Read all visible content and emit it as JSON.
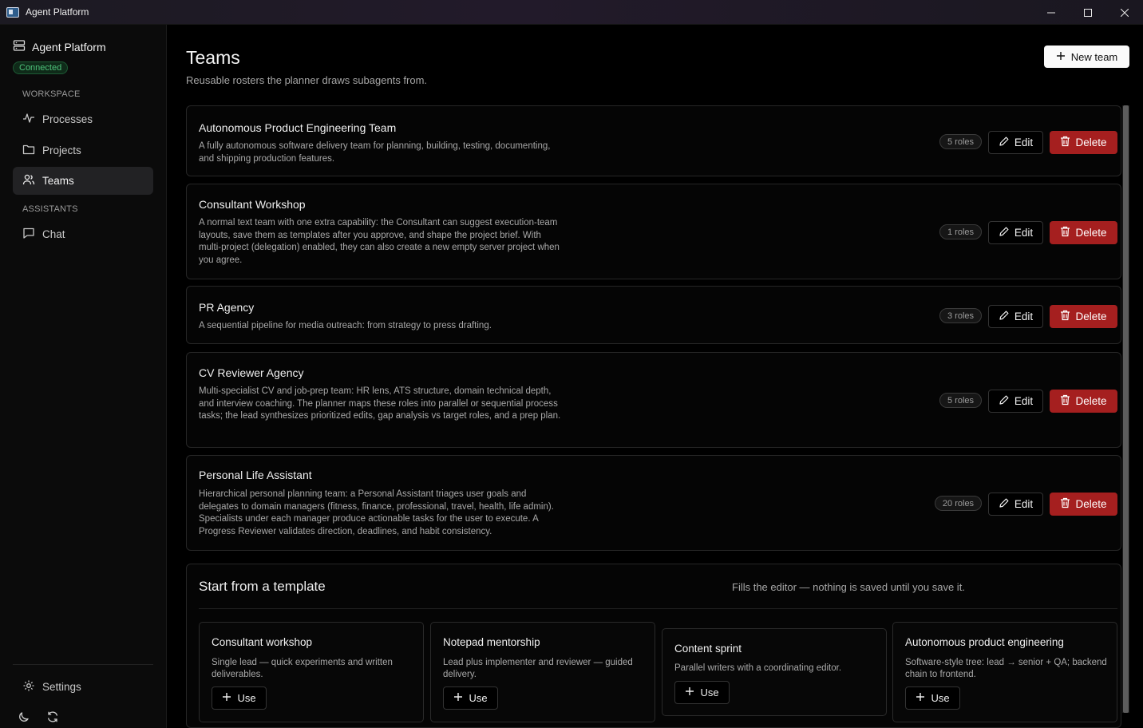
{
  "window": {
    "title": "Agent Platform"
  },
  "sidebar": {
    "brand": "Agent Platform",
    "status": "Connected",
    "sections": [
      {
        "label": "WORKSPACE",
        "items": [
          {
            "label": "Processes",
            "icon": "activity-icon"
          },
          {
            "label": "Projects",
            "icon": "folder-icon"
          },
          {
            "label": "Teams",
            "icon": "users-icon",
            "active": true
          }
        ]
      },
      {
        "label": "ASSISTANTS",
        "items": [
          {
            "label": "Chat",
            "icon": "chat-icon"
          }
        ]
      }
    ],
    "settings_label": "Settings"
  },
  "header": {
    "title": "Teams",
    "subtitle": "Reusable rosters the planner draws subagents from.",
    "new_button": "New team"
  },
  "teams": [
    {
      "name": "Autonomous Product Engineering Team",
      "description": "A fully autonomous software delivery team for planning, building, testing, documenting, and shipping production features.",
      "roles": "5 roles"
    },
    {
      "name": "Consultant Workshop",
      "description": "A normal text team with one extra capability: the Consultant can suggest execution-team layouts, save them as templates after you approve, and shape the project brief. With multi-project (delegation) enabled, they can also create a new empty server project when you agree.",
      "roles": "1 roles"
    },
    {
      "name": "PR Agency",
      "description": "A sequential pipeline for media outreach: from strategy to press drafting.",
      "roles": "3 roles"
    },
    {
      "name": "CV Reviewer Agency",
      "description": "Multi-specialist CV and job-prep team: HR lens, ATS structure, domain technical depth, and interview coaching. The planner maps these roles into parallel or sequential process tasks; the lead synthesizes prioritized edits, gap analysis vs target roles, and a prep plan.",
      "roles": "5 roles"
    },
    {
      "name": "Personal Life Assistant",
      "description": "Hierarchical personal planning team: a Personal Assistant triages user goals and delegates to domain managers (fitness, finance, professional, travel, health, life admin). Specialists under each manager produce actionable tasks for the user to execute. A Progress Reviewer validates direction, deadlines, and habit consistency.",
      "roles": "20 roles"
    }
  ],
  "actions": {
    "edit": "Edit",
    "delete": "Delete",
    "use": "Use"
  },
  "templates": {
    "title": "Start from a template",
    "note": "Fills the editor — nothing is saved until you save it.",
    "items": [
      {
        "name": "Consultant workshop",
        "description": "Single lead — quick experiments and written deliverables."
      },
      {
        "name": "Notepad mentorship",
        "description": "Lead plus implementer and reviewer — guided delivery."
      },
      {
        "name": "Content sprint",
        "description": "Parallel writers with a coordinating editor."
      },
      {
        "name": "Autonomous product engineering",
        "description": "Software-style tree: lead → senior + QA; backend chain to frontend."
      }
    ]
  },
  "colors": {
    "delete": "#a51f1f",
    "connected": "#4ec27a",
    "background": "#000000"
  }
}
